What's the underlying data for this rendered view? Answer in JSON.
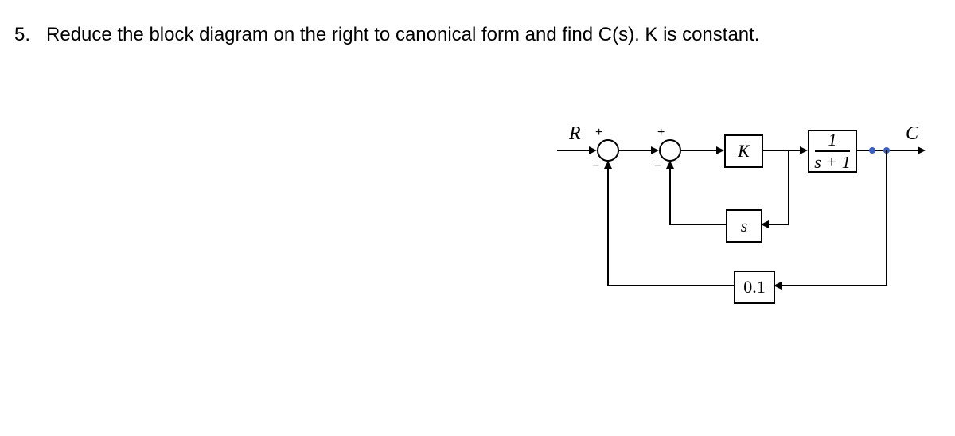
{
  "question": {
    "number": "5.",
    "text": "Reduce the block diagram on the right to canonical form and find C(s). K is constant."
  },
  "diagram": {
    "input_label": "R",
    "output_label": "C",
    "sum1": {
      "top_sign": "+",
      "bottom_sign": "−"
    },
    "sum2": {
      "top_sign": "+",
      "bottom_sign": "−"
    },
    "block_forward1": "K",
    "block_forward2": {
      "num": "1",
      "den": "s + 1"
    },
    "block_feedback_inner": "s",
    "block_feedback_outer": "0.1"
  },
  "chart_data": {
    "type": "block-diagram",
    "input": "R",
    "output": "C",
    "forward_path": [
      "sum1",
      "sum2",
      "K",
      "1/(s+1)"
    ],
    "inner_loop": {
      "from_node_after": "K",
      "block": "s",
      "to": "sum2",
      "sign": "-"
    },
    "outer_loop": {
      "from_node_after": "1/(s+1)",
      "block": "0.1",
      "to": "sum1",
      "sign": "-"
    },
    "pickoff_points": [
      "after K (inner feedback)",
      "after 1/(s+1) (outer feedback & output)"
    ]
  }
}
